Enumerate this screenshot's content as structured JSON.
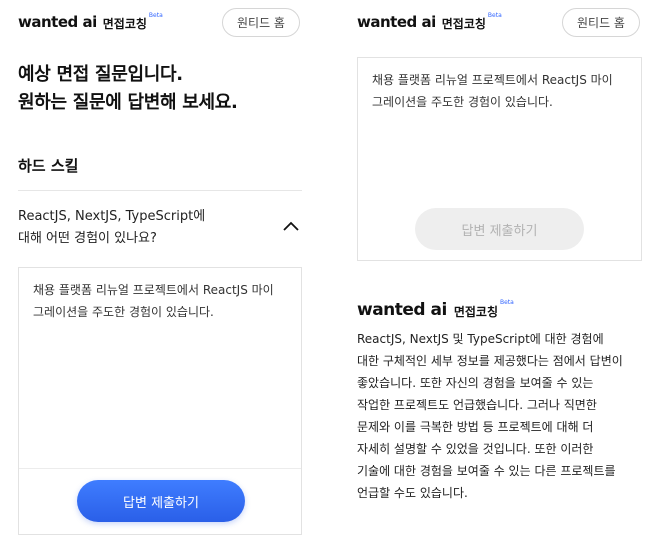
{
  "brand": {
    "logo_main": "wanted ai",
    "logo_sub": "면접코칭",
    "logo_badge": "Beta",
    "accent": "#3366ff"
  },
  "header": {
    "home_button": "원티드 홈"
  },
  "left": {
    "title_line1": "예상 면접 질문입니다.",
    "title_line2": "원하는 질문에 답변해 보세요.",
    "section_title": "하드 스킬",
    "question_line1": "ReactJS, NextJS, TypeScript에",
    "question_line2": "대해 어떤 경험이 있나요?",
    "answer_line1": "채용 플랫폼 리뉴얼 프로젝트에서 ReactJS 마이",
    "answer_line2": "그레이션을 주도한 경험이 있습니다.",
    "submit_label": "답변 제출하기"
  },
  "right": {
    "answer_line1": "채용 플랫폼 리뉴얼 프로젝트에서 ReactJS 마이",
    "answer_line2": "그레이션을 주도한 경험이 있습니다.",
    "submit_label": "답변 제출하기",
    "feedback_lines": [
      "ReactJS, NextJS 및 TypeScript에 대한 경험에",
      "대한 구체적인 세부 정보를 제공했다는 점에서 답변이",
      "좋았습니다. 또한 자신의 경험을 보여줄 수 있는",
      "작업한 프로젝트도 언급했습니다. 그러나 직면한",
      "문제와 이를 극복한 방법 등 프로젝트에 대해 더",
      "자세히 설명할 수 있었을 것입니다. 또한 이러한",
      "기술에 대한 경험을 보여줄 수 있는 다른 프로젝트를",
      "언급할 수도 있습니다."
    ]
  }
}
